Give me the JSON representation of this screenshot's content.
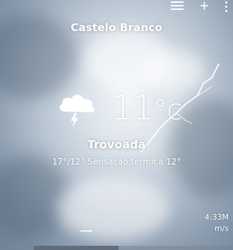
{
  "toolbar": {
    "list_icon": "list-icon",
    "add_label": "+",
    "menu_icon": "more-vert-icon"
  },
  "location": {
    "name": "Castelo Branco"
  },
  "current": {
    "icon": "thunderstorm-icon",
    "temperature": "11",
    "unit": "°c",
    "condition": "Trovoada",
    "details": "17°/12° Sensação térmica 12°"
  },
  "bottom": {
    "line1": "4:33M",
    "line2": "m/s"
  },
  "colors": {
    "text": "#ffffff",
    "sky_light": "#f2f5f8",
    "sky_dark": "#6f8298"
  }
}
